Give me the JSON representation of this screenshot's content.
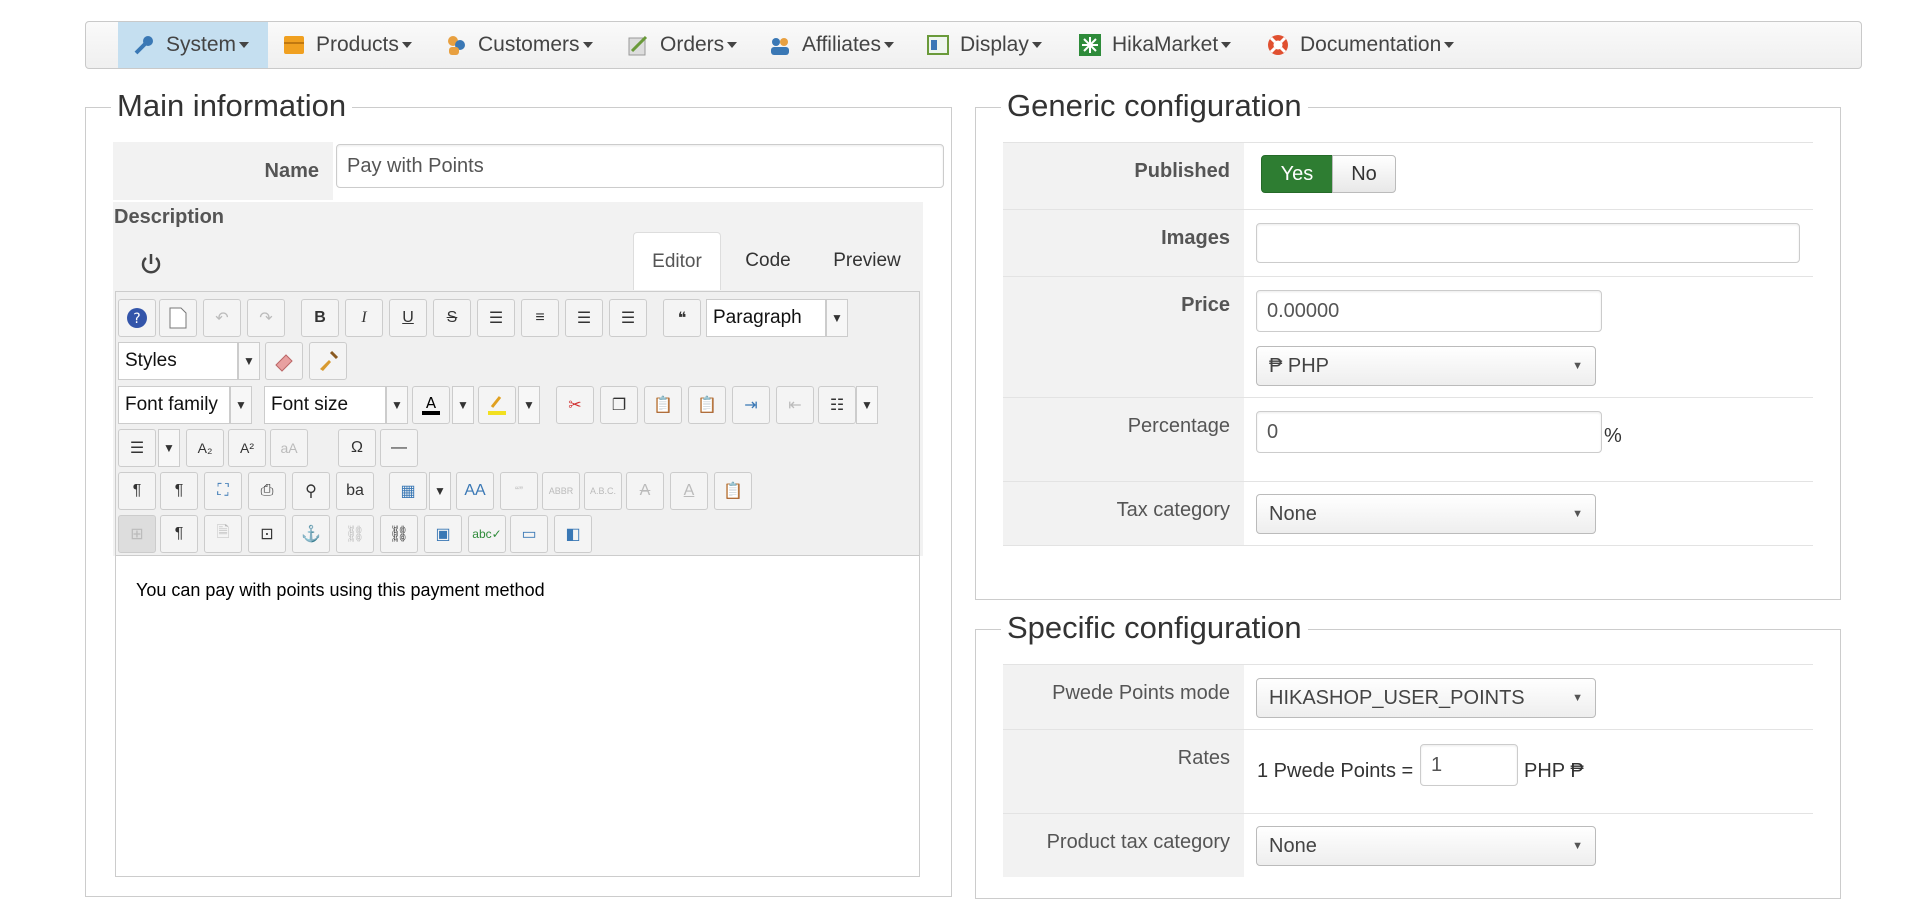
{
  "nav": {
    "items": [
      {
        "label": "System",
        "icon": "wrench-icon"
      },
      {
        "label": "Products",
        "icon": "box-icon"
      },
      {
        "label": "Customers",
        "icon": "users-icon"
      },
      {
        "label": "Orders",
        "icon": "orders-icon"
      },
      {
        "label": "Affiliates",
        "icon": "affiliates-icon"
      },
      {
        "label": "Display",
        "icon": "display-icon"
      },
      {
        "label": "HikaMarket",
        "icon": "hikamarket-icon"
      },
      {
        "label": "Documentation",
        "icon": "lifebuoy-icon"
      }
    ]
  },
  "main": {
    "legend": "Main information",
    "name_label": "Name",
    "name_value": "Pay with Points",
    "description_label": "Description",
    "tabs": [
      "Editor",
      "Code",
      "Preview"
    ],
    "toolbar": {
      "format_value": "Paragraph",
      "styles_value": "Styles",
      "font_family_value": "Font family",
      "font_size_value": "Font size"
    },
    "editor_content": "You can pay with points using this payment method"
  },
  "generic": {
    "legend": "Generic configuration",
    "published_label": "Published",
    "yes_label": "Yes",
    "no_label": "No",
    "images_label": "Images",
    "price_label": "Price",
    "price_value": "0.00000",
    "currency_value": "₱ PHP",
    "percentage_label": "Percentage",
    "percentage_value": "0",
    "percent_sign": "%",
    "tax_label": "Tax category",
    "tax_value": "None"
  },
  "specific": {
    "legend": "Specific configuration",
    "mode_label": "Pwede Points mode",
    "mode_value": "HIKASHOP_USER_POINTS",
    "rates_label": "Rates",
    "rates_prefix": "1 Pwede Points =",
    "rates_value": "1",
    "rates_suffix": "PHP ₱",
    "product_tax_label": "Product tax category",
    "product_tax_value": "None"
  },
  "colors": {
    "accent_green": "#2e7d32",
    "nav_active": "#c5dff0"
  }
}
